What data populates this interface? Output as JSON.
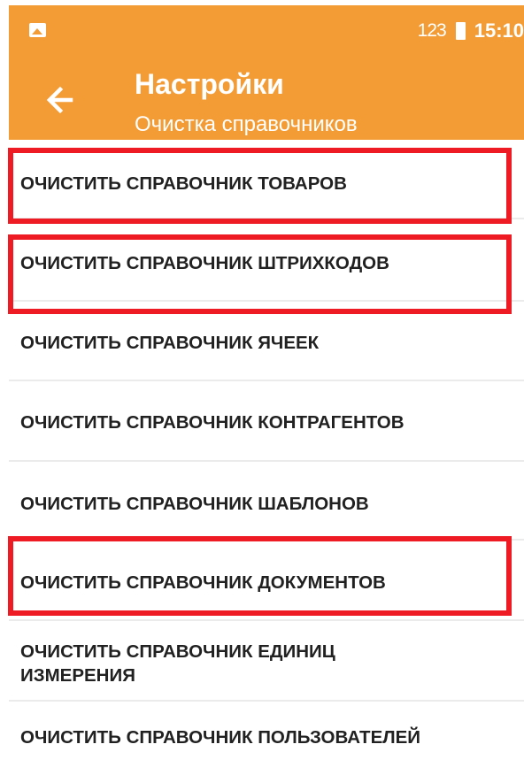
{
  "status_bar": {
    "image_notification_icon": "image-icon",
    "input_indicator": "123",
    "battery_icon": "battery-icon",
    "time": "15:10"
  },
  "app_bar": {
    "back_icon": "arrow-left-icon",
    "title": "Настройки",
    "subtitle": "Очистка справочников",
    "background_color": "#F39C35"
  },
  "menu": {
    "items": [
      {
        "label": "ОЧИСТИТЬ СПРАВОЧНИК ТОВАРОВ",
        "highlighted": true
      },
      {
        "label": "ОЧИСТИТЬ СПРАВОЧНИК ШТРИХКОДОВ",
        "highlighted": true
      },
      {
        "label": "ОЧИСТИТЬ СПРАВОЧНИК ЯЧЕЕК",
        "highlighted": false
      },
      {
        "label": "ОЧИСТИТЬ СПРАВОЧНИК КОНТРАГЕНТОВ",
        "highlighted": false
      },
      {
        "label": "ОЧИСТИТЬ СПРАВОЧНИК ШАБЛОНОВ",
        "highlighted": false
      },
      {
        "label": "ОЧИСТИТЬ СПРАВОЧНИК ДОКУМЕНТОВ",
        "highlighted": true
      },
      {
        "label": "ОЧИСТИТЬ СПРАВОЧНИК ЕДИНИЦ ИЗМЕРЕНИЯ",
        "highlighted": false
      },
      {
        "label": "ОЧИСТИТЬ СПРАВОЧНИК ПОЛЬЗОВАТЕЛЕЙ",
        "highlighted": false
      }
    ]
  },
  "highlight_color": "#EE1A24"
}
